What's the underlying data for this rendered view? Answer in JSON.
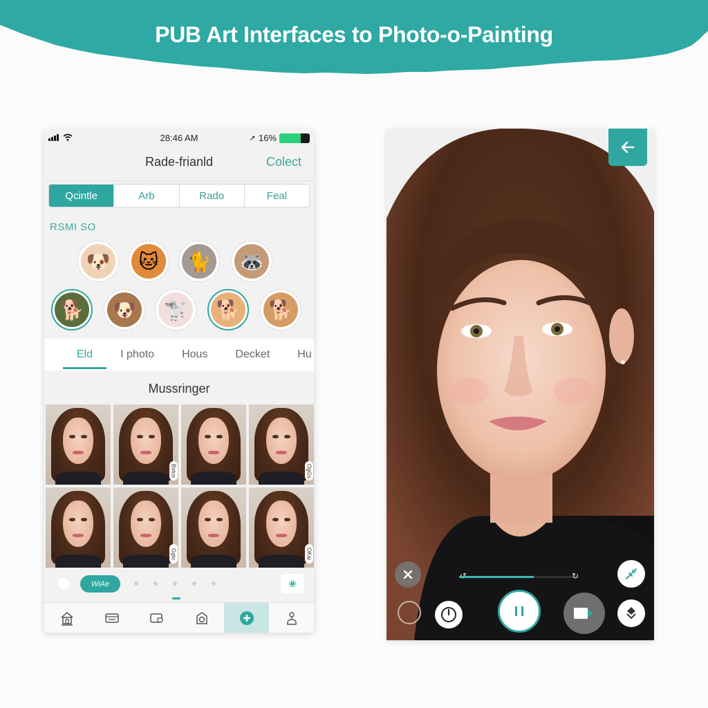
{
  "banner": {
    "title": "PUB Art Interfaces to Photo-o-Painting",
    "color": "#2ea9a3"
  },
  "theme": {
    "accent": "#2fa7a0",
    "battery_green": "#2ad17a"
  },
  "left_phone": {
    "status_bar": {
      "time": "28:46 AM",
      "battery_label": "16%",
      "battery_level": 0.7,
      "icons": [
        "cellular-signal-icon",
        "wifi-icon",
        "location-arrow-icon",
        "battery-icon"
      ]
    },
    "nav": {
      "title": "Rade-frianld",
      "action_label": "Colect"
    },
    "segments": [
      {
        "label": "Qcintle",
        "active": true
      },
      {
        "label": "Arb",
        "active": false
      },
      {
        "label": "Rado",
        "active": false
      },
      {
        "label": "Feal",
        "active": false
      }
    ],
    "section_label": "RSMI SO",
    "avatars": [
      {
        "name": "pomeranian",
        "glyph": "🐶",
        "bg": "#f0d3b5",
        "selected": false
      },
      {
        "name": "orange-cat",
        "glyph": "🐱",
        "bg": "#e08a3c",
        "selected": false
      },
      {
        "name": "tabby-cat",
        "glyph": "🐈",
        "bg": "#a49a93",
        "selected": false
      },
      {
        "name": "raccoon-dog",
        "glyph": "🦝",
        "bg": "#c59b76",
        "selected": false
      },
      {
        "name": "rottweiler",
        "glyph": "🐕",
        "bg": "#5a6e3d",
        "selected": true
      },
      {
        "name": "pug",
        "glyph": "🐶",
        "bg": "#a7784e",
        "selected": false
      },
      {
        "name": "samoyed",
        "glyph": "🐩",
        "bg": "#f3dede",
        "selected": false
      },
      {
        "name": "golden-retriever",
        "glyph": "🐕",
        "bg": "#e9b27a",
        "selected": true
      },
      {
        "name": "shiba-inu",
        "glyph": "🐕",
        "bg": "#d59c64",
        "selected": false
      }
    ],
    "tabs": [
      {
        "label": "Eld",
        "active": true
      },
      {
        "label": "I photo",
        "active": false
      },
      {
        "label": "Hous",
        "active": false
      },
      {
        "label": "Decket",
        "active": false
      },
      {
        "label": "Hu",
        "active": false
      }
    ],
    "collection_title": "Mussringer",
    "photos": [
      {
        "watermark": ""
      },
      {
        "watermark": "Bstus"
      },
      {
        "watermark": ""
      },
      {
        "watermark": "OgGs"
      },
      {
        "watermark": ""
      },
      {
        "watermark": "Gglo"
      },
      {
        "watermark": ""
      },
      {
        "watermark": "OKai"
      }
    ],
    "pager": {
      "pill_label": "WiAe",
      "dot_count": 5,
      "action_icon": "sticker-icon"
    },
    "bottom_nav": [
      {
        "name": "home",
        "active": false
      },
      {
        "name": "gallery",
        "active": false
      },
      {
        "name": "badge",
        "active": false
      },
      {
        "name": "camera",
        "active": false
      },
      {
        "name": "add",
        "active": true
      },
      {
        "name": "profile",
        "active": false
      }
    ]
  },
  "right_phone": {
    "back_label": "←",
    "progress": 0.63,
    "rewind_label": "↺",
    "forward_label": "↻"
  }
}
